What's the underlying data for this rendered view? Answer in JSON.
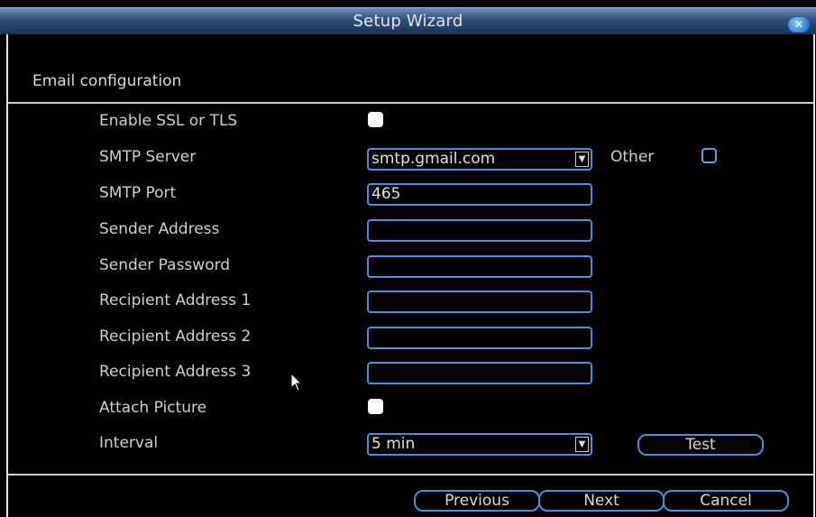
{
  "window": {
    "title": "Setup Wizard"
  },
  "section": {
    "title": "Email configuration"
  },
  "form": {
    "ssl_label": "Enable SSL or TLS",
    "smtp_server_label": "SMTP Server",
    "smtp_server_value": "smtp.gmail.com",
    "other_label": "Other",
    "smtp_port_label": "SMTP Port",
    "smtp_port_value": "465",
    "sender_address_label": "Sender Address",
    "sender_password_label": "Sender Password",
    "recipient1_label": "Recipient Address 1",
    "recipient2_label": "Recipient Address 2",
    "recipient3_label": "Recipient Address 3",
    "attach_picture_label": "Attach Picture",
    "interval_label": "Interval",
    "interval_value": "5 min",
    "test_label": "Test"
  },
  "footer": {
    "previous_label": "Previous",
    "next_label": "Next",
    "cancel_label": "Cancel"
  },
  "colors": {
    "accent": "#4a8fd8",
    "titlebar": "#2d4f7a",
    "background": "#000000"
  }
}
